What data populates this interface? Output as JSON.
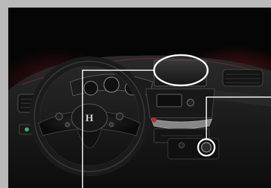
{
  "image": {
    "subject": "car-dashboard-interior",
    "brand_mark": "H",
    "colors": {
      "border": "#b9b9b9",
      "background": "#050505",
      "callout": "#ffffff",
      "accent_glow": "#b0202a"
    },
    "callouts": [
      {
        "target": "navigation-screen"
      },
      {
        "target": "start-button"
      }
    ]
  }
}
